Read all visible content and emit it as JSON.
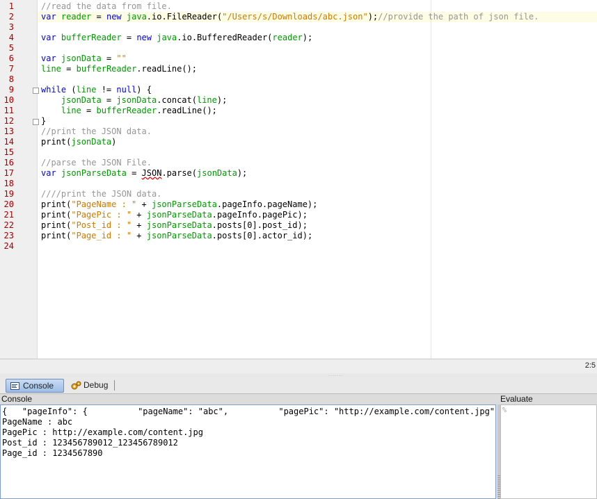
{
  "editor": {
    "line_numbers": [
      "1",
      "2",
      "3",
      "4",
      "5",
      "6",
      "7",
      "8",
      "9",
      "10",
      "11",
      "12",
      "13",
      "14",
      "15",
      "16",
      "17",
      "18",
      "19",
      "20",
      "21",
      "22",
      "23",
      "24"
    ],
    "lines": {
      "l1": {
        "c1": "//read the data from file."
      },
      "l2": {
        "a": "var",
        "b": " ",
        "c": "reader",
        "d": " = ",
        "e": "new",
        "f": " ",
        "g": "java",
        "h": ".io.FileReader(",
        "i": "\"/Users/s/Downloads/abc.json\"",
        "j": ");",
        "k": "//provide the path of json file."
      },
      "l4": {
        "a": "var",
        "b": " ",
        "c": "bufferReader",
        "d": " = ",
        "e": "new",
        "f": " ",
        "g": "java",
        "h": ".io.BufferedReader(",
        "i": "reader",
        "j": ");"
      },
      "l6": {
        "a": "var",
        "b": " ",
        "c": "jsonData",
        "d": " = ",
        "e": "\"\""
      },
      "l7": {
        "a": "line",
        "b": " = ",
        "c": "bufferReader",
        "d": ".readLine();"
      },
      "l9": {
        "a": "while",
        "b": " (",
        "c": "line",
        "d": " != ",
        "e": "null",
        "f": ") {"
      },
      "l10": {
        "a": "    ",
        "b": "jsonData",
        "c": " = ",
        "d": "jsonData",
        "e": ".concat(",
        "f": "line",
        "g": ");"
      },
      "l11": {
        "a": "    ",
        "b": "line",
        "c": " = ",
        "d": "bufferReader",
        "e": ".readLine();"
      },
      "l12": {
        "a": "}"
      },
      "l13": {
        "c1": "//print the JSON data."
      },
      "l14": {
        "a": "print(",
        "b": "jsonData",
        "c": ")"
      },
      "l16": {
        "c1": "//parse the JSON File."
      },
      "l17": {
        "a": "var",
        "b": " ",
        "c": "jsonParseData",
        "d": " = ",
        "e": "JSON",
        "f": ".parse(",
        "g": "jsonData",
        "h": ");"
      },
      "l19": {
        "c1": "////print the JSON data."
      },
      "l20": {
        "a": "print(",
        "b": "\"PageName : \"",
        "c": " + ",
        "d": "jsonParseData",
        "e": ".pageInfo.pageName);"
      },
      "l21": {
        "a": "print(",
        "b": "\"PagePic : \"",
        "c": " + ",
        "d": "jsonParseData",
        "e": ".pageInfo.pagePic);"
      },
      "l22": {
        "a": "print(",
        "b": "\"Post_id : \"",
        "c": " + ",
        "d": "jsonParseData",
        "e": ".posts[0].post_id);"
      },
      "l23": {
        "a": "print(",
        "b": "\"Page_id : \"",
        "c": " + ",
        "d": "jsonParseData",
        "e": ".posts[0].actor_id);"
      }
    }
  },
  "status": {
    "position": "2:5"
  },
  "tabs": {
    "console": "Console",
    "debug": "Debug"
  },
  "console": {
    "title": "Console",
    "output": [
      "{   \"pageInfo\": {          \"pageName\": \"abc\",          \"pagePic\": \"http://example.com/content.jpg\"    }",
      "PageName : abc",
      "PagePic : http://example.com/content.jpg",
      "Post_id : 123456789012_123456789012",
      "Page_id : 1234567890"
    ]
  },
  "evaluate": {
    "title": "Evaluate",
    "prompt": "%"
  },
  "colors": {
    "keyword": "#0000e6",
    "string": "#ce7b00",
    "identifier": "#009900",
    "comment": "#969696",
    "line_number": "#a00000"
  }
}
